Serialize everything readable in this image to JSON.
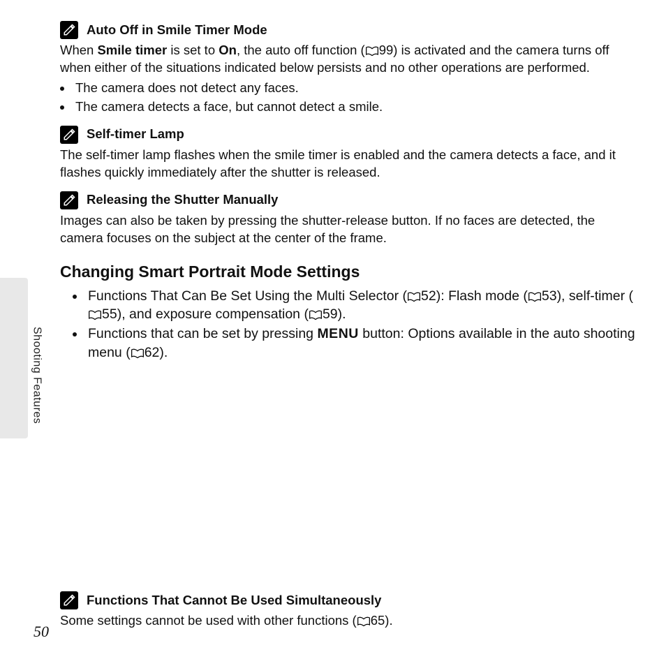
{
  "page_number": "50",
  "side_label": "Shooting Features",
  "sec1": {
    "title": "Auto Off in Smile Timer Mode",
    "p_before": "When ",
    "bold1": "Smile timer",
    "p_mid1": " is set to ",
    "bold2": "On",
    "p_mid2": ", the auto off function (",
    "ref1": "99",
    "p_after": ") is activated and the camera turns off when either of the situations indicated below persists and no other operations are performed.",
    "bullets": [
      "The camera does not detect any faces.",
      "The camera detects a face, but cannot detect a smile."
    ]
  },
  "sec2": {
    "title": "Self-timer Lamp",
    "p": "The self-timer lamp flashes when the smile timer is enabled and the camera detects a face, and it flashes quickly immediately after the shutter is released."
  },
  "sec3": {
    "title": "Releasing the Shutter Manually",
    "p": "Images can also be taken by pressing the shutter-release button. If no faces are detected, the camera focuses on the subject at the center of the frame."
  },
  "h2": "Changing Smart Portrait Mode Settings",
  "b1": {
    "t1": "Functions That Can Be Set Using the Multi Selector (",
    "r1": "52",
    "t2": "): Flash mode (",
    "r2": "53",
    "t3": "), self-timer (",
    "r3": "55",
    "t4": "), and exposure compensation (",
    "r4": "59",
    "t5": ")."
  },
  "b2": {
    "t1": "Functions that can be set by pressing ",
    "menu": "MENU",
    "t2": " button: Options available in the auto shooting menu (",
    "r1": "62",
    "t3": ")."
  },
  "sec4": {
    "title": "Functions That Cannot Be Used Simultaneously",
    "p_before": "Some settings cannot be used with other functions (",
    "ref": "65",
    "p_after": ")."
  }
}
